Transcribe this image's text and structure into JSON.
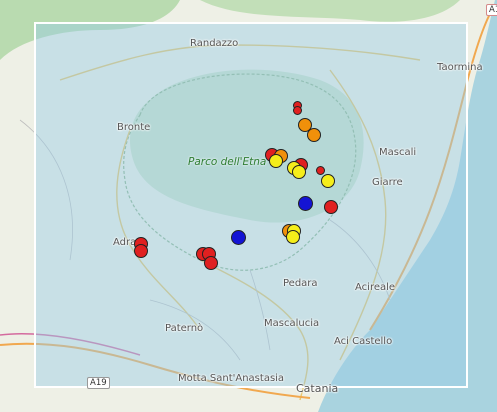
{
  "map": {
    "places": [
      {
        "id": "randazzo",
        "name": "Randazzo"
      },
      {
        "id": "taormina",
        "name": "Taormina"
      },
      {
        "id": "bronte",
        "name": "Bronte"
      },
      {
        "id": "mascali",
        "name": "Mascali"
      },
      {
        "id": "giarre",
        "name": "Giarre"
      },
      {
        "id": "adrano",
        "name": "Adra"
      },
      {
        "id": "pedara",
        "name": "Pedara"
      },
      {
        "id": "acireale",
        "name": "Acireale"
      },
      {
        "id": "paterno",
        "name": "Paternò"
      },
      {
        "id": "mascalucia",
        "name": "Mascalucia"
      },
      {
        "id": "aci-castello",
        "name": "Aci Castello"
      },
      {
        "id": "motta",
        "name": "Motta Sant'Anastasia"
      },
      {
        "id": "catania",
        "name": "Catania"
      }
    ],
    "park_label": "Parco dell'Etna",
    "road_shields": {
      "a19": "A19",
      "a18": "A1"
    },
    "marker_colors": {
      "red": "#e02020",
      "orange": "#f0900a",
      "yellow": "#f5ee1a",
      "blue": "#1414d4"
    },
    "selection_box": {
      "fill": "#99cce6",
      "border": "#ffffff"
    }
  }
}
